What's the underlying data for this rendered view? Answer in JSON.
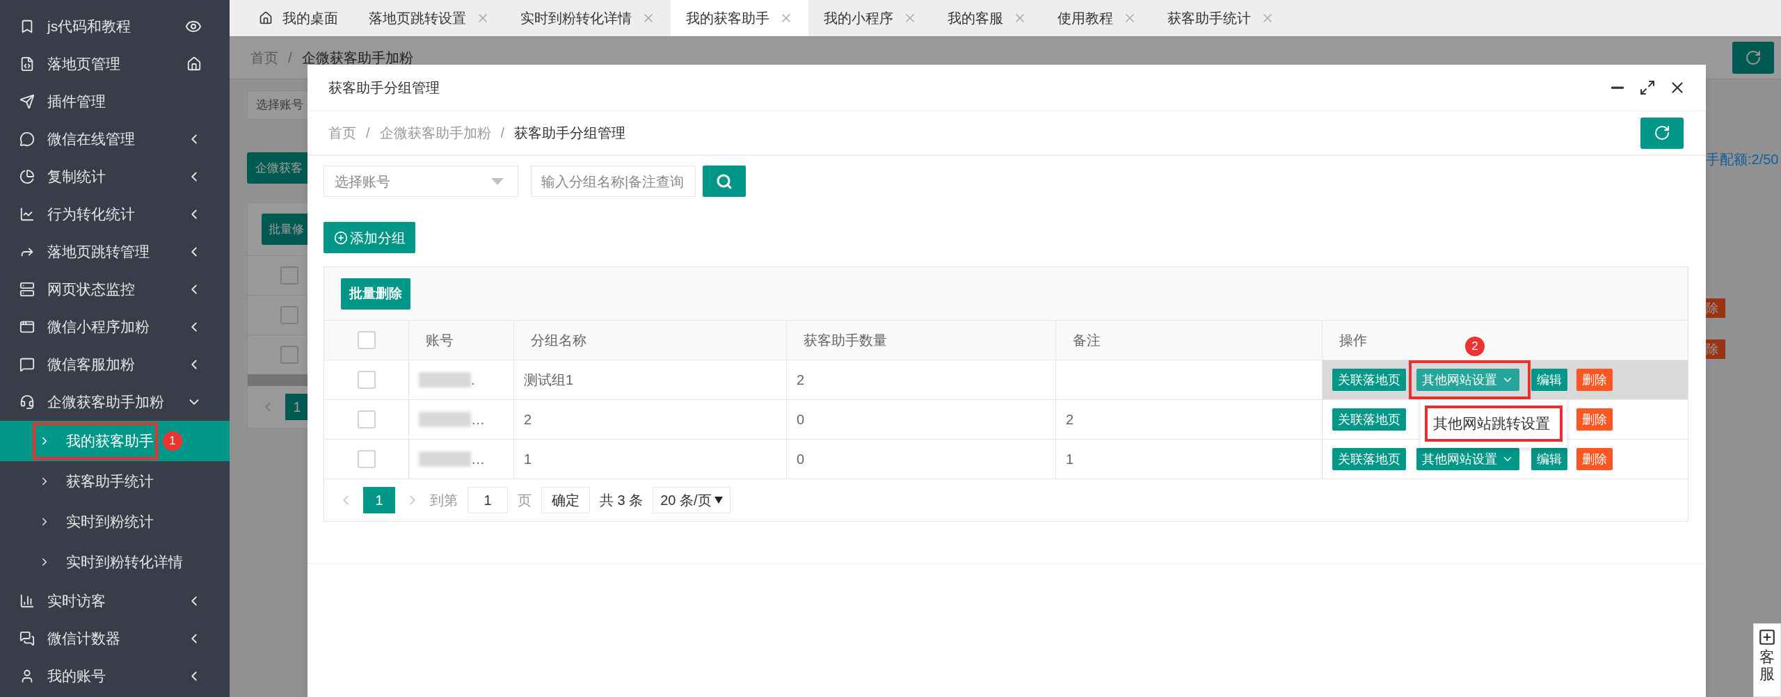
{
  "sidebar": {
    "items": [
      {
        "kind": "page",
        "label": "js代码和教程"
      },
      {
        "kind": "page",
        "label": "落地页管理"
      },
      {
        "kind": "plain",
        "label": "插件管理"
      },
      {
        "kind": "group",
        "label": "微信在线管理",
        "expanded": false
      },
      {
        "kind": "group",
        "label": "复制统计",
        "expanded": false
      },
      {
        "kind": "group",
        "label": "行为转化统计",
        "expanded": false
      },
      {
        "kind": "group",
        "label": "落地页跳转管理",
        "expanded": false
      },
      {
        "kind": "group",
        "label": "网页状态监控",
        "expanded": false
      },
      {
        "kind": "group",
        "label": "微信小程序加粉",
        "expanded": false
      },
      {
        "kind": "group",
        "label": "微信客服加粉",
        "expanded": false
      },
      {
        "kind": "group",
        "label": "企微获客助手加粉",
        "expanded": true,
        "children": [
          {
            "label": "我的获客助手",
            "selected": true,
            "callout": "1"
          },
          {
            "label": "获客助手统计",
            "selected": false
          },
          {
            "label": "实时到粉统计",
            "selected": false
          },
          {
            "label": "实时到粉转化详情",
            "selected": false
          }
        ]
      },
      {
        "kind": "group",
        "label": "实时访客",
        "expanded": false
      },
      {
        "kind": "group",
        "label": "微信计数器",
        "expanded": false
      },
      {
        "kind": "group",
        "label": "我的账号",
        "expanded": false
      }
    ]
  },
  "tabs": [
    {
      "label": "我的桌面",
      "selected": false,
      "closable": false
    },
    {
      "label": "落地页跳转设置",
      "selected": false,
      "closable": true
    },
    {
      "label": "实时到粉转化详情",
      "selected": false,
      "closable": true
    },
    {
      "label": "我的获客助手",
      "selected": true,
      "closable": true
    },
    {
      "label": "我的小程序",
      "selected": false,
      "closable": true
    },
    {
      "label": "我的客服",
      "selected": false,
      "closable": true
    },
    {
      "label": "使用教程",
      "selected": false,
      "closable": true
    },
    {
      "label": "获客助手统计",
      "selected": false,
      "closable": true
    }
  ],
  "background_page": {
    "breadcrumb": [
      "首页",
      "企微获客助手加粉"
    ],
    "breadcrumb_separator": "/",
    "account_select": "选择账号",
    "add_button": "企微获客",
    "batch_button": "批量修",
    "quota": "手配额:2/50",
    "header_checked": false,
    "rows": [
      {
        "checked": false,
        "delete": "除"
      },
      {
        "checked": false,
        "delete": "除"
      }
    ],
    "pager": {
      "current": "1"
    }
  },
  "dialog": {
    "title": "获客助手分组管理",
    "breadcrumb": [
      "首页",
      "企微获客助手加粉",
      "获客助手分组管理"
    ],
    "breadcrumb_separator": "/",
    "account_select": {
      "placeholder": "选择账号"
    },
    "search": {
      "placeholder": "输入分组名称|备注查询"
    },
    "add_button": "添加分组",
    "batch_delete": "批量删除",
    "table": {
      "columns": [
        "账号",
        "分组名称",
        "获客助手数量",
        "备注",
        "操作"
      ],
      "header_checked": false,
      "rows": [
        {
          "checked": false,
          "account": ".",
          "name": "测试组1",
          "count": "2",
          "highlighted": true,
          "actions": [
            {
              "kind": "link",
              "label": "关联落地页"
            },
            {
              "kind": "dropdown",
              "label": "其他网站设置",
              "callout": "2"
            },
            {
              "kind": "edit",
              "label": "编辑"
            },
            {
              "kind": "delete",
              "label": "删除"
            }
          ]
        },
        {
          "checked": false,
          "account": "…",
          "name": "2",
          "count": "0",
          "note": "2",
          "highlighted": false,
          "actions": [
            {
              "kind": "link",
              "label": "关联落地页"
            },
            {
              "kind": "delete",
              "label": "删除"
            }
          ]
        },
        {
          "checked": false,
          "account": "…",
          "name": "1",
          "count": "0",
          "note": "1",
          "highlighted": false,
          "actions": [
            {
              "kind": "link",
              "label": "关联落地页"
            },
            {
              "kind": "dropdown",
              "label": "其他网站设置"
            },
            {
              "kind": "edit",
              "label": "编辑"
            },
            {
              "kind": "delete",
              "label": "删除"
            }
          ]
        }
      ]
    },
    "dropdown_menu": {
      "items": [
        {
          "label": "其他网站跳转设置",
          "outlined": true
        }
      ]
    },
    "pager": {
      "pages": [
        {
          "label": "1",
          "selected": true
        }
      ],
      "goto_label": "到第",
      "goto_value": "1",
      "page_unit": "页",
      "confirm": "确定",
      "total": "共 3 条",
      "page_size": "20 条/页"
    }
  },
  "service_widget": {
    "label": "客服"
  }
}
